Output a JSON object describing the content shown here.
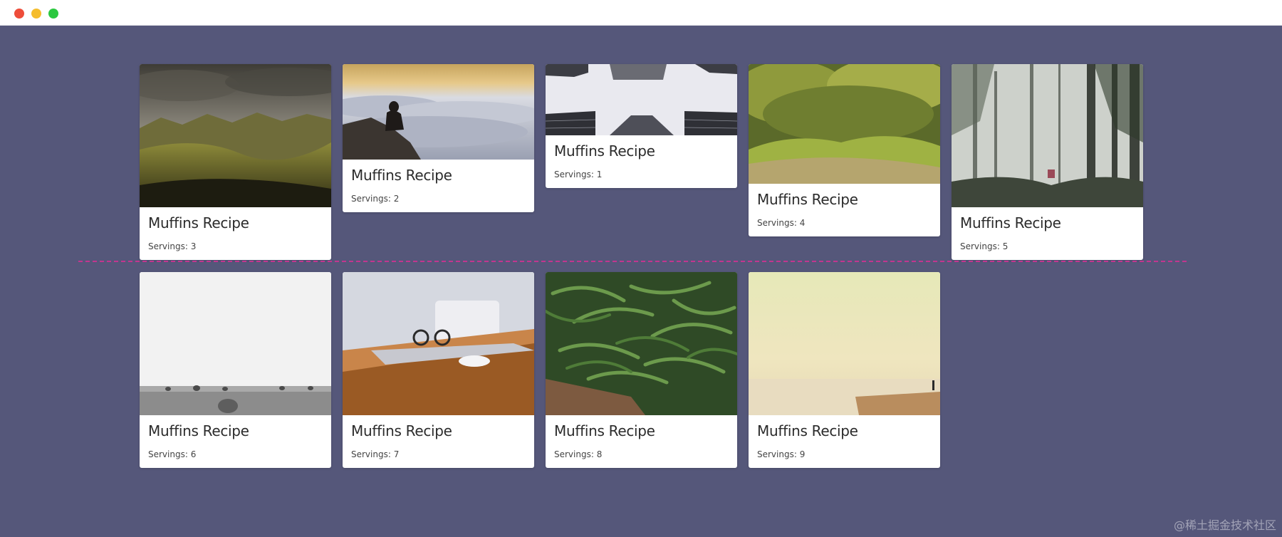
{
  "window": {
    "controls": [
      "close",
      "minimize",
      "maximize"
    ]
  },
  "colors": {
    "background": "#55577a",
    "divider": "#c1368f"
  },
  "cards": [
    {
      "title": "Muffins Recipe",
      "servings": "Servings: 3",
      "image": "cloudy-mountains"
    },
    {
      "title": "Muffins Recipe",
      "servings": "Servings: 2",
      "image": "man-above-clouds"
    },
    {
      "title": "Muffins Recipe",
      "servings": "Servings: 1",
      "image": "skyscrapers-looking-up"
    },
    {
      "title": "Muffins Recipe",
      "servings": "Servings: 4",
      "image": "mossy-forest-floor"
    },
    {
      "title": "Muffins Recipe",
      "servings": "Servings: 5",
      "image": "misty-forest"
    },
    {
      "title": "Muffins Recipe",
      "servings": "Servings: 6",
      "image": "hay-bale-field"
    },
    {
      "title": "Muffins Recipe",
      "servings": "Servings: 7",
      "image": "laptop-glasses-desk"
    },
    {
      "title": "Muffins Recipe",
      "servings": "Servings: 8",
      "image": "green-beans"
    },
    {
      "title": "Muffins Recipe",
      "servings": "Servings: 9",
      "image": "hazy-seaside"
    }
  ],
  "watermark": "@稀土掘金技术社区"
}
